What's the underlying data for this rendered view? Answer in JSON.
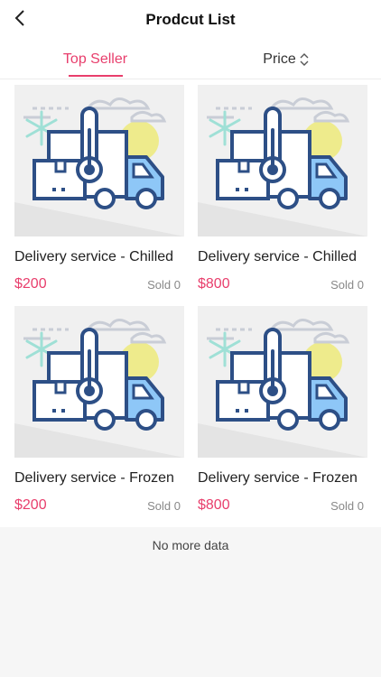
{
  "header": {
    "title": "Prodcut List"
  },
  "tabs": {
    "top_seller": "Top Seller",
    "price": "Price"
  },
  "products": [
    {
      "name": "Delivery service - Chilled",
      "price": "$200",
      "sold": "Sold 0"
    },
    {
      "name": "Delivery service - Chilled",
      "price": "$800",
      "sold": "Sold 0"
    },
    {
      "name": "Delivery service - Frozen",
      "price": "$200",
      "sold": "Sold 0"
    },
    {
      "name": "Delivery service - Frozen",
      "price": "$800",
      "sold": "Sold 0"
    }
  ],
  "footer": {
    "no_more": "No more data"
  },
  "colors": {
    "accent": "#e83e6c"
  },
  "icons": {
    "back": "chevron-left-icon",
    "sort": "sort-updown-icon",
    "thumbnail": "delivery-truck-thermometer-icon"
  }
}
